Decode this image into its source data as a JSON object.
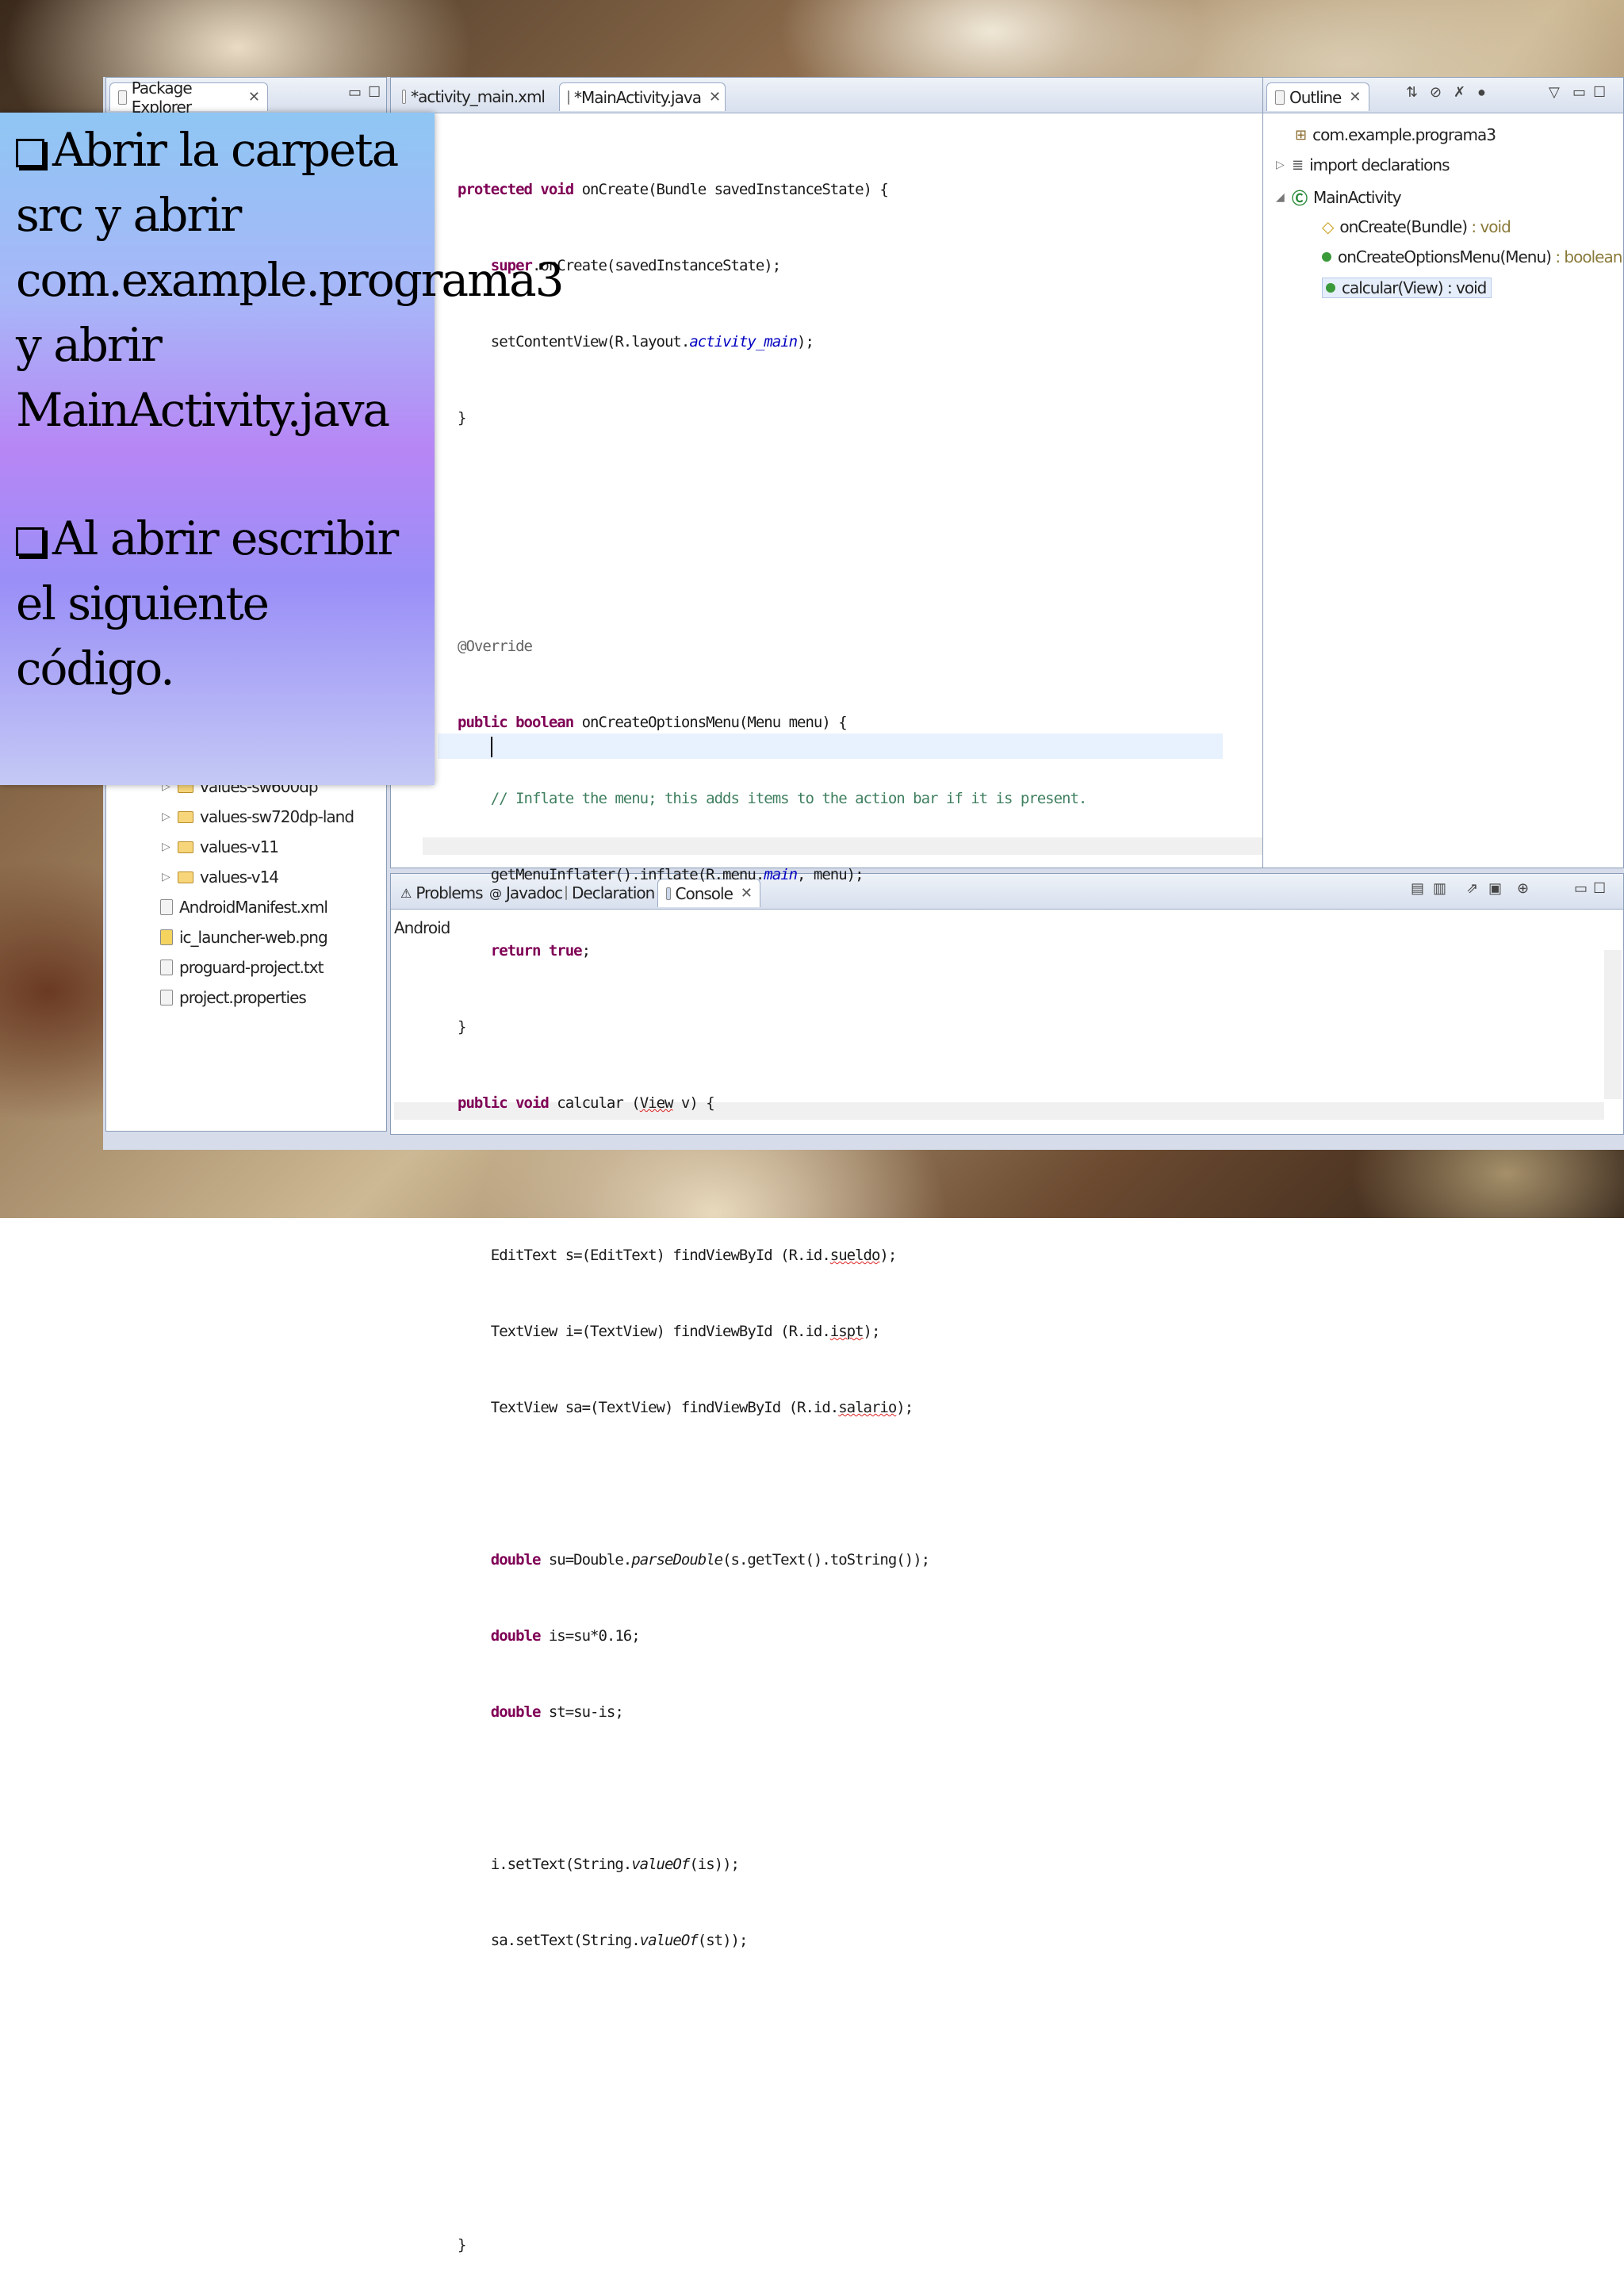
{
  "package_explorer": {
    "tab_label": "Package Explorer",
    "items": [
      {
        "label": "values-sw600dp",
        "type": "folder"
      },
      {
        "label": "values-sw720dp-land",
        "type": "folder"
      },
      {
        "label": "values-v11",
        "type": "folder"
      },
      {
        "label": "values-v14",
        "type": "folder"
      },
      {
        "label": "AndroidManifest.xml",
        "type": "file"
      },
      {
        "label": "ic_launcher-web.png",
        "type": "file"
      },
      {
        "label": "proguard-project.txt",
        "type": "file"
      },
      {
        "label": "project.properties",
        "type": "file"
      }
    ]
  },
  "editor": {
    "tabs": [
      {
        "label": "*activity_main.xml"
      },
      {
        "label": "*MainActivity.java"
      }
    ],
    "code": {
      "l1": {
        "kw": "protected void",
        "rest": " onCreate(Bundle savedInstanceState) {"
      },
      "l2": {
        "kw": "super",
        "rest": ".onCreate(savedInstanceState);"
      },
      "l3": {
        "pre": "setContentView(R.layout.",
        "fld": "activity_main",
        "post": ");"
      },
      "l4": "}",
      "l5": "@Override",
      "l6": {
        "kw": "public boolean",
        "rest": " onCreateOptionsMenu(Menu menu) {"
      },
      "l7": "// Inflate the menu; this adds items to the action bar if it is present.",
      "l8": {
        "pre": "getMenuInflater().inflate(R.menu.",
        "fld": "main",
        "post": ", menu);"
      },
      "l9": {
        "kw": "return",
        "kw2": "true",
        "post": ";"
      },
      "l10": "}",
      "l11": {
        "kw": "public void",
        "pre": " calcular (",
        "sq": "View",
        "post": " v) {"
      },
      "l12": {
        "pre": "EditText s=(EditText) findViewById (R.id.",
        "sq": "sueldo",
        "post": ");"
      },
      "l13": {
        "pre": "TextView i=(TextView) findViewById (R.id.",
        "sq": "ispt",
        "post": ");"
      },
      "l14": {
        "pre": "TextView sa=(TextView) findViewById (R.id.",
        "sq": "salario",
        "post": ");"
      },
      "l15": {
        "kw": "double",
        "pre": " su=Double.",
        "it": "parseDouble",
        "post": "(s.getText().toString());"
      },
      "l16": {
        "kw": "double",
        "post": " is=su*0.16;"
      },
      "l17": {
        "kw": "double",
        "post": " st=su-is;"
      },
      "l18": {
        "pre": "i.setText(String.",
        "it": "valueOf",
        "post": "(is));"
      },
      "l19": {
        "pre": "sa.setText(String.",
        "it": "valueOf",
        "post": "(st));"
      },
      "l20": "}"
    }
  },
  "outline": {
    "tab_label": "Outline",
    "items": [
      {
        "label": "com.example.programa3"
      },
      {
        "label": "import declarations"
      },
      {
        "label": "MainActivity"
      },
      {
        "label": "onCreate(Bundle)",
        "type": " : void"
      },
      {
        "label": "onCreateOptionsMenu(Menu)",
        "type": " : boolean"
      },
      {
        "label": "calcular(View)",
        "type": " : void"
      }
    ]
  },
  "bottom_panel": {
    "tabs": [
      {
        "label": "Problems"
      },
      {
        "label": "Javadoc"
      },
      {
        "label": "Declaration"
      },
      {
        "label": "Console"
      }
    ],
    "console_title": "Android"
  },
  "slide_text": {
    "bullet1": "Abrir la carpeta src y abrir com.example.programa3 y abrir MainActivity.java",
    "bullet2": "Al abrir escribir el siguiente código."
  }
}
